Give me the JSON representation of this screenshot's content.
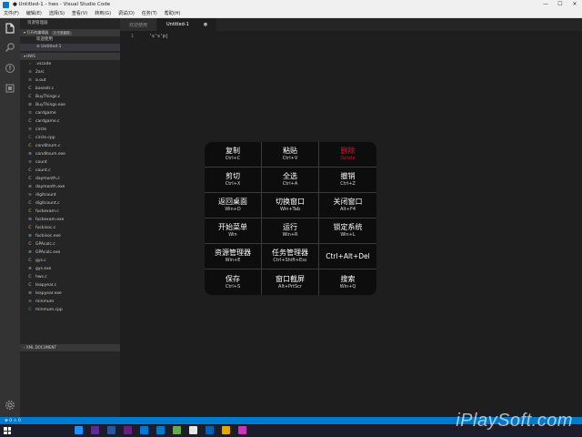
{
  "window": {
    "title": "● Untitled-1 - hws - Visual Studio Code",
    "controls": [
      "—",
      "☐",
      "✕"
    ]
  },
  "menu": [
    "文件(F)",
    "编辑(E)",
    "选择(S)",
    "查看(V)",
    "转到(G)",
    "调试(D)",
    "任务(T)",
    "帮助(H)"
  ],
  "activity_icons": [
    "explorer-icon",
    "search-icon",
    "source-control-icon",
    "debug-icon",
    "extensions-icon",
    "gear-icon"
  ],
  "sidebar": {
    "title": "资源管理器",
    "open_editors": {
      "label": "▾ 打开的编辑器",
      "badge": "1 个未保存",
      "files": [
        {
          "name": "欢迎使用",
          "active": false
        },
        {
          "name": "≡ Untitled-1",
          "active": true
        }
      ]
    },
    "folder": {
      "label": "▾ HWS",
      "files": [
        {
          "icon": "›",
          "type": "doc",
          "name": ".vscode"
        },
        {
          "icon": "≡",
          "type": "doc",
          "name": "2arc"
        },
        {
          "icon": "≡",
          "type": "doc",
          "name": "a.out"
        },
        {
          "icon": "C",
          "type": "c",
          "name": "basestr.c"
        },
        {
          "icon": "C",
          "type": "c",
          "name": "BuyThings.c"
        },
        {
          "icon": "≡",
          "type": "exe",
          "name": "BuyThings.exe"
        },
        {
          "icon": "≡",
          "type": "doc",
          "name": "cardgame"
        },
        {
          "icon": "C",
          "type": "c",
          "name": "cardgame.c"
        },
        {
          "icon": "≡",
          "type": "doc",
          "name": "circle"
        },
        {
          "icon": "C",
          "type": "cpp",
          "name": "circle.cpp"
        },
        {
          "icon": "C",
          "type": "c",
          "name": "conditsum.c"
        },
        {
          "icon": "≡",
          "type": "exe",
          "name": "conditsum.exe"
        },
        {
          "icon": "≡",
          "type": "doc",
          "name": "count"
        },
        {
          "icon": "C",
          "type": "c",
          "name": "count.c"
        },
        {
          "icon": "C",
          "type": "c",
          "name": "daymonth.c"
        },
        {
          "icon": "≡",
          "type": "exe",
          "name": "daymonth.exe"
        },
        {
          "icon": "≡",
          "type": "doc",
          "name": "digitcount"
        },
        {
          "icon": "C",
          "type": "c",
          "name": "digitcount.c"
        },
        {
          "icon": "C",
          "type": "c",
          "name": "fuckexam.c"
        },
        {
          "icon": "≡",
          "type": "exe",
          "name": "fuckexam.exe"
        },
        {
          "icon": "C",
          "type": "c",
          "name": "fuckisoc.c"
        },
        {
          "icon": "≡",
          "type": "exe",
          "name": "fuckisoc.exe"
        },
        {
          "icon": "C",
          "type": "c",
          "name": "GPAcalc.c"
        },
        {
          "icon": "≡",
          "type": "exe",
          "name": "GPAcalc.exe"
        },
        {
          "icon": "C",
          "type": "c",
          "name": "gys.c"
        },
        {
          "icon": "≡",
          "type": "exe",
          "name": "gys.exe"
        },
        {
          "icon": "C",
          "type": "c",
          "name": "hws.c"
        },
        {
          "icon": "C",
          "type": "c",
          "name": "leapyear.c"
        },
        {
          "icon": "≡",
          "type": "exe",
          "name": "leapyear.exe"
        },
        {
          "icon": "≡",
          "type": "doc",
          "name": "minmum"
        },
        {
          "icon": "C",
          "type": "cpp",
          "name": "minmum.cpp"
        }
      ]
    },
    "xml_section": "› XML DOCUMENT"
  },
  "tabs": [
    {
      "label": "欢迎使用",
      "active": false,
      "close": ""
    },
    {
      "label": "Untitled-1",
      "active": true,
      "close": "●"
    }
  ],
  "editor": {
    "line_number": "1",
    "code": "'s's'p|"
  },
  "shortcuts": [
    {
      "name": "复制",
      "keys": "Ctrl+C"
    },
    {
      "name": "粘贴",
      "keys": "Ctrl+V"
    },
    {
      "name": "删除",
      "keys": "Delete",
      "accent": "#e81123"
    },
    {
      "name": "剪切",
      "keys": "Ctrl+X"
    },
    {
      "name": "全选",
      "keys": "Ctrl+A"
    },
    {
      "name": "撤销",
      "keys": "Ctrl+Z"
    },
    {
      "name": "返回桌面",
      "keys": "Win+D"
    },
    {
      "name": "切换窗口",
      "keys": "Win+Tab"
    },
    {
      "name": "关闭窗口",
      "keys": "Alt+F4"
    },
    {
      "name": "开始菜单",
      "keys": "Win"
    },
    {
      "name": "运行",
      "keys": "Win+R"
    },
    {
      "name": "锁定系统",
      "keys": "Win+L"
    },
    {
      "name": "资源管理器",
      "keys": "Win+E"
    },
    {
      "name": "任务管理器",
      "keys": "Ctrl+Shift+Esc"
    },
    {
      "name": "Ctrl+Alt+Del",
      "keys": ""
    },
    {
      "name": "保存",
      "keys": "Ctrl+S"
    },
    {
      "name": "窗口截屏",
      "keys": "Alt+PrtScr"
    },
    {
      "name": "搜索",
      "keys": "Win+Q"
    }
  ],
  "statusbar": {
    "text": "⊗ 0 ⚠ 0"
  },
  "taskbar_colors": [
    "#1e90ff",
    "#5c2d91",
    "#2b579a",
    "#68217a",
    "#0078d7",
    "#007acc",
    "#6aa84f",
    "#e6e6e6",
    "#0063b1",
    "#e0a800",
    "#c239b3"
  ],
  "watermark": "iPlaySoft.com"
}
